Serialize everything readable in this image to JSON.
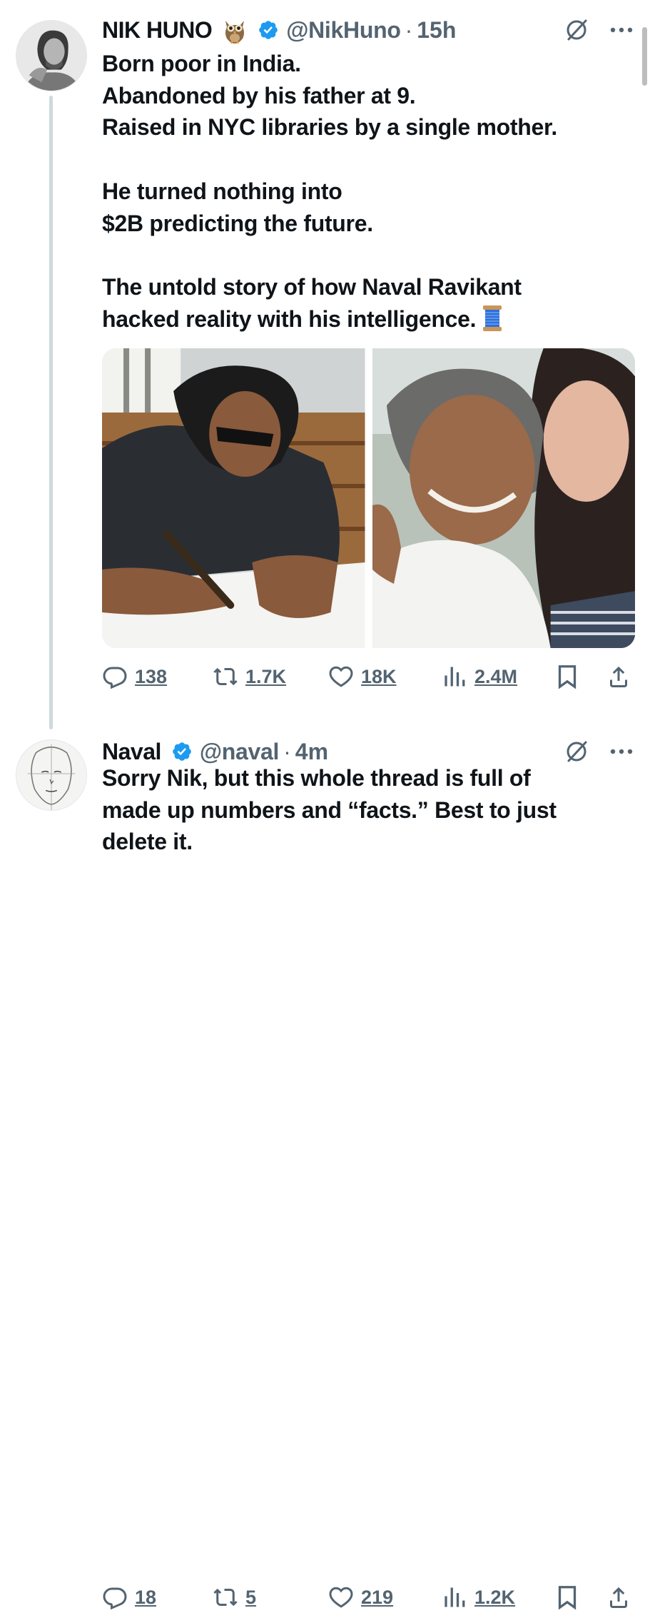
{
  "tweets": [
    {
      "author_name": "NIK HUNO",
      "handle": "@NikHuno",
      "time": "15h",
      "separator": "·",
      "text": "Born poor in India.\nAbandoned by his father at 9.\nRaised in NYC libraries by a single mother.\n\nHe turned nothing into\n$2B predicting the future.\n\nThe untold story of how Naval Ravikant\nhacked reality with his intelligence.",
      "emoji_after_name": "owl-icon",
      "emoji_after_text": "spool-of-thread-icon",
      "verified": true,
      "media": [
        "photo",
        "photo"
      ],
      "stats": {
        "replies": "138",
        "reposts": "1.7K",
        "likes": "18K",
        "views": "2.4M"
      }
    },
    {
      "author_name": "Naval",
      "handle": "@naval",
      "time": "4m",
      "separator": "·",
      "text": "Sorry Nik, but this whole thread is full of\nmade up numbers and “facts.” Best to just\ndelete it.",
      "verified": true,
      "stats": {
        "replies": "18",
        "reposts": "5",
        "likes": "219",
        "views": "1.2K"
      }
    }
  ],
  "colors": {
    "text": "#0f1419",
    "secondary": "#536471",
    "verified_blue": "#1d9bf0",
    "thread_line": "#cfd9de"
  }
}
